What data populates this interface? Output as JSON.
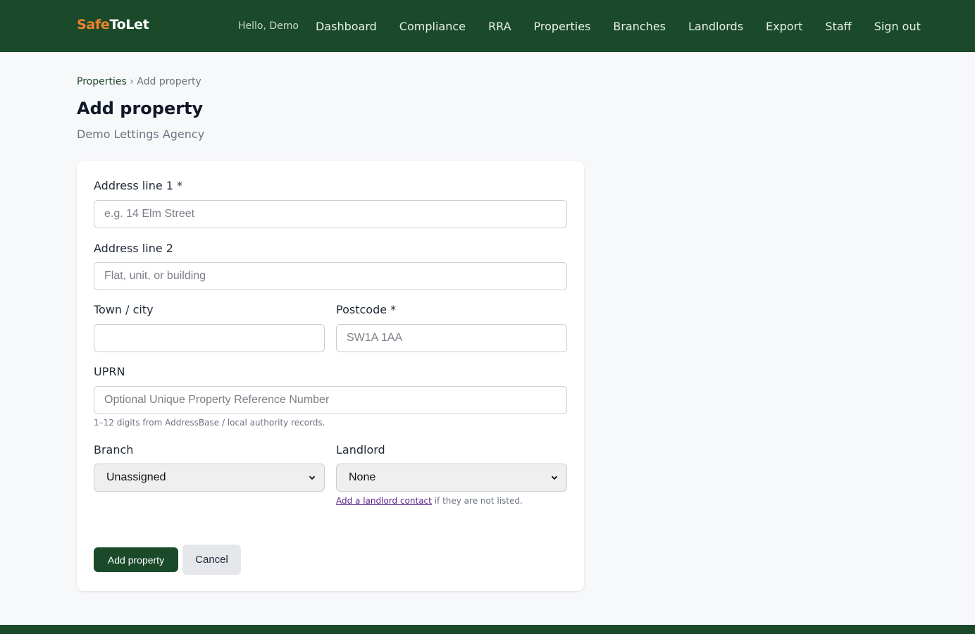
{
  "brand": {
    "part1": "Safe",
    "part2": "ToLet"
  },
  "header": {
    "greeting": "Hello, Demo",
    "nav": [
      "Dashboard",
      "Compliance",
      "RRA",
      "Properties",
      "Branches",
      "Landlords",
      "Export",
      "Staff",
      "Sign out"
    ]
  },
  "breadcrumb": {
    "parent": "Properties",
    "separator": " › ",
    "current": "Add property"
  },
  "page": {
    "title": "Add property",
    "subtitle": "Demo Lettings Agency"
  },
  "form": {
    "address1": {
      "label": "Address line 1 *",
      "placeholder": "e.g. 14 Elm Street",
      "value": ""
    },
    "address2": {
      "label": "Address line 2",
      "placeholder": "Flat, unit, or building",
      "value": ""
    },
    "town": {
      "label": "Town / city",
      "placeholder": "",
      "value": ""
    },
    "postcode": {
      "label": "Postcode *",
      "placeholder": "SW1A 1AA",
      "value": ""
    },
    "uprn": {
      "label": "UPRN",
      "placeholder": "Optional Unique Property Reference Number",
      "value": "",
      "hint": "1–12 digits from AddressBase / local authority records."
    },
    "branch": {
      "label": "Branch",
      "selected": "Unassigned"
    },
    "landlord": {
      "label": "Landlord",
      "selected": "None",
      "hint_link": "Add a landlord contact",
      "hint_text": " if they are not listed."
    },
    "submit_label": "Add property",
    "cancel_label": "Cancel"
  },
  "colors": {
    "brand_green": "#1b4a2b",
    "brand_orange": "#f0842b",
    "link_purple": "#5b1f8a"
  },
  "icons": {
    "select": "chevron-down-icon"
  }
}
